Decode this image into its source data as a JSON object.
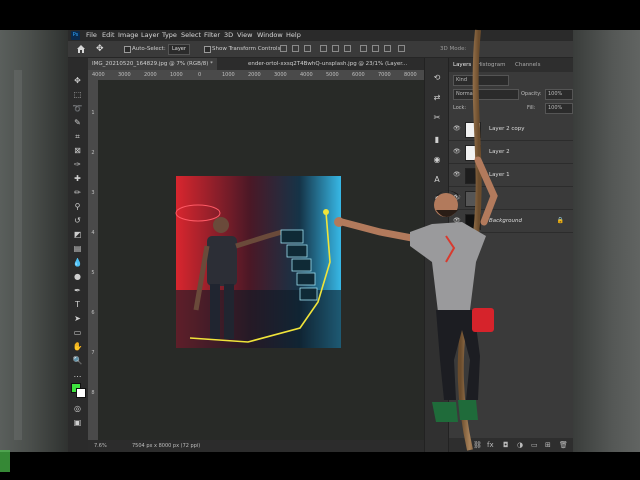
{
  "menubar": {
    "app_icon": "Ps",
    "items": [
      "File",
      "Edit",
      "Image",
      "Layer",
      "Type",
      "Select",
      "Filter",
      "3D",
      "View",
      "Window",
      "Help"
    ]
  },
  "options_bar": {
    "auto_select_label": "Auto-Select:",
    "auto_select_value": "Layer",
    "show_transform_label": "Show Transform Controls",
    "mode_3d_label": "3D Mode:",
    "icons": [
      "home-icon",
      "move-icon"
    ]
  },
  "document": {
    "tabs": [
      {
        "label": "IMG_20210520_164829.jpg @ 7% (RGB/8) *",
        "active": true
      },
      {
        "label": "ender-ortol-xxsq2T4BwhQ-unsplash.jpg @ 23/1% (Layer...",
        "active": false
      }
    ],
    "ruler_h_ticks": [
      "4000",
      "3000",
      "2000",
      "1000",
      "0",
      "1000",
      "2000",
      "3000",
      "4000",
      "5000",
      "6000",
      "7000",
      "8000"
    ],
    "ruler_v_ticks": [
      "1",
      "2",
      "3",
      "4",
      "5",
      "6",
      "7",
      "8"
    ],
    "status": {
      "zoom": "7.6%",
      "info": "7504 px x 8000 px (72 ppi)"
    }
  },
  "layers_panel": {
    "tabs": [
      "Layers",
      "Histogram",
      "Channels"
    ],
    "filter_label": "Kind",
    "blend_mode": "Normal",
    "opacity_label": "Opacity:",
    "opacity_value": "100%",
    "lock_label": "Lock:",
    "fill_label": "Fill:",
    "fill_value": "100%",
    "layers": [
      {
        "name": "Layer 2 copy",
        "visible": true,
        "locked": false
      },
      {
        "name": "Layer 2",
        "visible": true,
        "locked": false
      },
      {
        "name": "Layer 1",
        "visible": true,
        "locked": false
      },
      {
        "name": "",
        "visible": true,
        "locked": false
      },
      {
        "name": "Background",
        "visible": true,
        "locked": true
      }
    ],
    "footer_icons": [
      "link-icon",
      "fx-icon",
      "mask-icon",
      "adjustment-icon",
      "folder-icon",
      "new-layer-icon",
      "trash-icon"
    ]
  },
  "colors": {
    "foreground": "#3ee23e",
    "background": "#ffffff",
    "accent_red": "#e2322e",
    "accent_cyan": "#3fd7ff",
    "selection_yellow": "#f0e43a"
  }
}
